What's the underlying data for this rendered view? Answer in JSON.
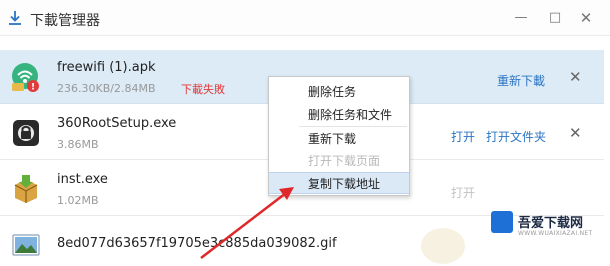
{
  "window": {
    "title": "下載管理器",
    "controls": {
      "minimize": "—",
      "maximize": "□",
      "close": "✕"
    }
  },
  "downloads": [
    {
      "name": "freewifi (1).apk",
      "size": "236.30KB/2.84MB",
      "status": "下載失敗",
      "action": "重新下載",
      "icon": "apk-wifi-icon"
    },
    {
      "name": "360RootSetup.exe",
      "size": "3.86MB",
      "actions": [
        "打开",
        "打开文件夹"
      ],
      "icon": "exe-setup-icon"
    },
    {
      "name": "inst.exe",
      "size": "1.02MB",
      "actions": [
        "打开"
      ],
      "icon": "exe-installer-icon"
    },
    {
      "name": "8ed077d63657f19705e3c885da039082.gif",
      "icon": "image-file-icon"
    }
  ],
  "row_close": "✕",
  "context_menu": {
    "items": [
      "删除任务",
      "删除任务和文件",
      "重新下载",
      "打开下载页面",
      "复制下载地址"
    ],
    "disabled": [
      false,
      false,
      false,
      true,
      false
    ],
    "highlighted_index": 4
  },
  "watermark": {
    "brand": "吾爱下载网",
    "url": "WWW.WUAIXIAZAI.NET"
  },
  "colors": {
    "selection": "#dcebf6",
    "link": "#2b74c4",
    "error": "#e23b3b",
    "arrow": "#e0282a",
    "brand_blue": "#1e6fd6"
  }
}
